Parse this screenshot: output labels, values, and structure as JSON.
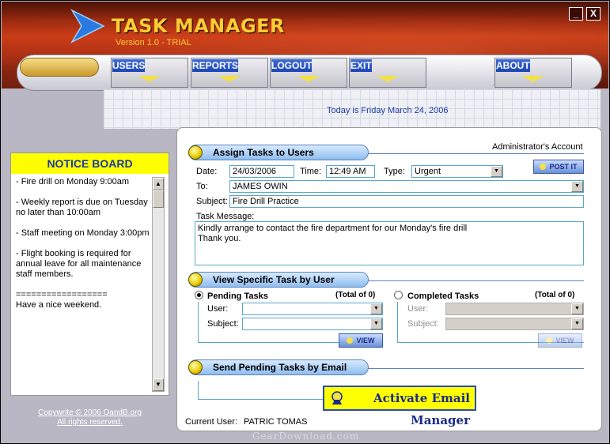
{
  "app": {
    "title": "TASK MANAGER",
    "version": "Version 1.0 -  TRIAL"
  },
  "window": {
    "minimize_label": "_",
    "close_label": "X"
  },
  "nav": [
    {
      "label": "USERS"
    },
    {
      "label": "REPORTS"
    },
    {
      "label": "LOGOUT"
    },
    {
      "label": "EXIT"
    },
    {
      "label": "ABOUT"
    }
  ],
  "today": "Today is Friday March 24, 2006",
  "notice": {
    "title": "NOTICE BOARD",
    "items": [
      "- Fire drill on Monday 9:00am",
      "- Weekly report is due on Tuesday no later than 10:00am",
      "- Staff meeting on Monday 3:00pm",
      "- Flight booking is required for annual leave for all maintenance staff members.",
      "==================\nHave a nice weekend."
    ]
  },
  "footer": {
    "copyright": "Copywrite © 2006 OandB.org",
    "rights": "All rights reserved."
  },
  "account": "Administrator's Account",
  "assign": {
    "heading": "Assign Tasks to Users",
    "date_label": "Date:",
    "date_value": "24/03/2006",
    "time_label": "Time:",
    "time_value": "12:49 AM",
    "type_label": "Type:",
    "type_value": "Urgent",
    "post_label": "POST IT",
    "to_label": "To:",
    "to_value": "JAMES OWIN",
    "subject_label": "Subject:",
    "subject_value": "Fire Drill Practice",
    "message_label": "Task Message:",
    "message_value": "Kindly arrange to contact the fire department for our Monday's fire drill\nThank you."
  },
  "view": {
    "heading": "View Specific Task by User",
    "pending": {
      "label": "Pending Tasks",
      "total": "(Total of 0)",
      "user_label": "User:",
      "subject_label": "Subject:",
      "button": "VIEW",
      "selected": true
    },
    "completed": {
      "label": "Completed Tasks",
      "total": "(Total of 0)",
      "user_label": "User:",
      "subject_label": "Subject:",
      "button": "VIEW",
      "selected": false
    }
  },
  "email": {
    "heading": "Send Pending Tasks by Email",
    "button": "Activate Email Manager"
  },
  "current_user": {
    "label": "Current User:",
    "value": "PATRIC TOMAS"
  },
  "watermark": "GearDownload.com",
  "colors": {
    "accent_yellow": "#ffcc33",
    "header_red": "#c53a16",
    "link_blue": "#1a3aa8"
  }
}
